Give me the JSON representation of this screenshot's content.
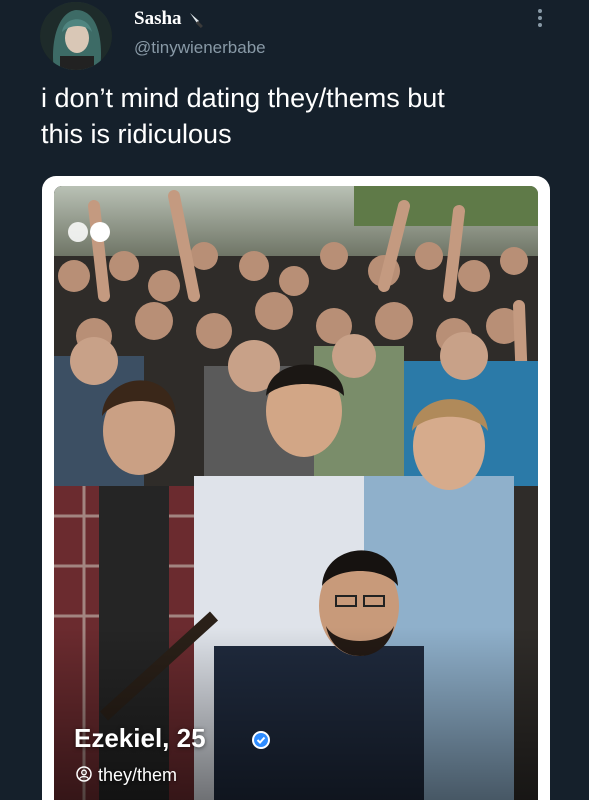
{
  "tweet": {
    "display_name": "Sasha",
    "handle": "@tinywienerbabe",
    "text_lines": [
      "i don’t mind dating they/thems but",
      "this is ridiculous"
    ]
  },
  "profile_card": {
    "name_age": "Ezekiel, 25",
    "pronouns": "they/them"
  },
  "icons": {
    "name_emoji": "knife-icon",
    "more": "more-vertical-icon",
    "verified": "verified-badge-icon",
    "pronoun": "person-circle-icon"
  },
  "colors": {
    "background": "#15202b",
    "secondary_text": "#8899a6",
    "verified": "#2f8cff"
  }
}
